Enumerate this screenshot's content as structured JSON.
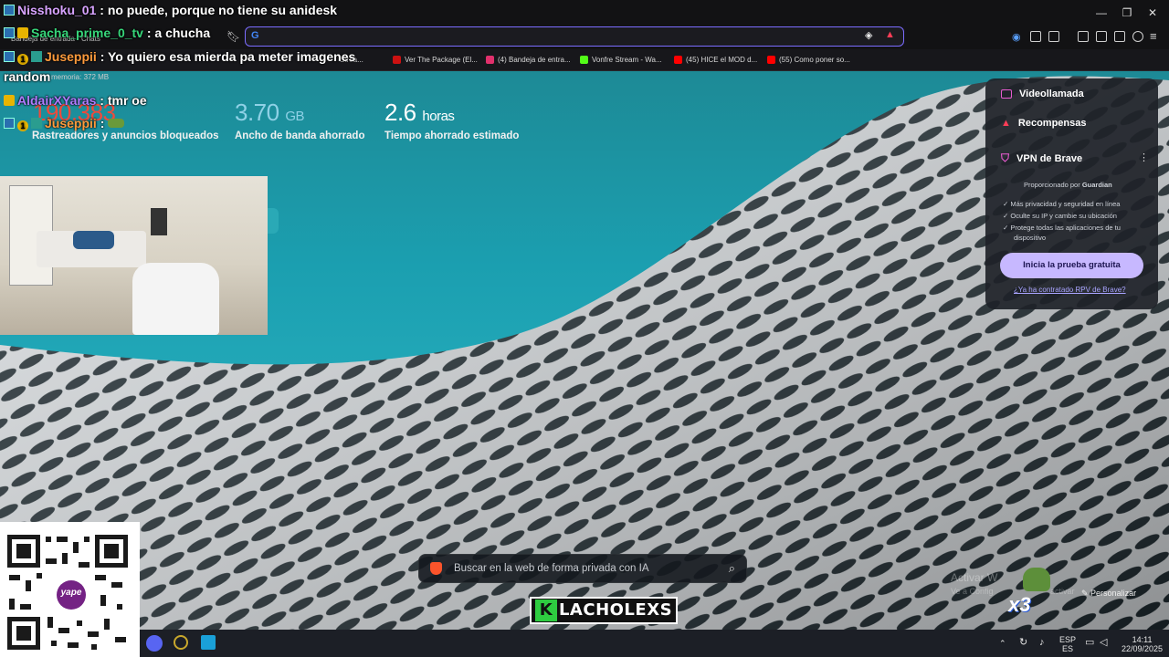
{
  "chat": [
    {
      "user": "Nisshoku_01",
      "user_color": "#d7a3ff",
      "message": ": no puede, porque no tiene su anidesk"
    },
    {
      "user": "Sacha_prime_0_tv",
      "user_color": "#37d67a",
      "message": ": a chucha"
    },
    {
      "user": "Juseppii",
      "user_color": "#ff9a3c",
      "message": ": Yo quiero esa mierda pa meter imagenes"
    },
    {
      "user": "",
      "user_color": "#ffffff",
      "message": "random"
    },
    {
      "user": "AldairXYaras",
      "user_color": "#b07bff",
      "message": ": tmr oe"
    },
    {
      "user": "Juseppii",
      "user_color": "#ff9a3c",
      "message": ":"
    }
  ],
  "tabs": {
    "tab1": "Bandeja de entrada - Chats",
    "memory": "memoria: 372 MB"
  },
  "bookmarks": [
    {
      "label": "Strea...",
      "color": "#9146ff"
    },
    {
      "label": "Ver The Package (El...",
      "color": "#c11"
    },
    {
      "label": "(4) Bandeja de entra...",
      "color": "#e1306c"
    },
    {
      "label": "Vonfre Stream - Wa...",
      "color": "#53fc18"
    },
    {
      "label": "(45) HICE el MOD d...",
      "color": "#ff0000"
    },
    {
      "label": "(55) Como poner so...",
      "color": "#ff0000"
    }
  ],
  "stats": {
    "blocked_value": "190.383",
    "blocked_label": "Rastreadores y anuncios bloqueados",
    "bandwidth_value": "3.70",
    "bandwidth_unit": "GB",
    "bandwidth_label": "Ancho de banda ahorrado",
    "time_value": "2.6",
    "time_unit": "horas",
    "time_label": "Tiempo ahorrado estimado"
  },
  "panel": {
    "video": "Videollamada",
    "rewards": "Recompensas",
    "vpn": "VPN de Brave",
    "provided": "Proporcionado por",
    "provider": "Guardian",
    "features": [
      "Más privacidad y seguridad en línea",
      "Oculte su IP y cambie su ubicación",
      "Protege todas las aplicaciones de tu",
      "dispositivo"
    ],
    "cta": "Inicia la prueba gratuita",
    "link": "¿Ya ha contratado RPV de Brave?"
  },
  "search": {
    "placeholder": "Buscar en la web de forma privada con IA"
  },
  "activate": {
    "line1": "Activar W",
    "line2": "Ve a Config",
    "line3": "activar"
  },
  "customize": "Personalizar",
  "emote_count": "x3",
  "logo_text": "LACHOLEXS",
  "logo_k": "K",
  "qr_brand": "yape",
  "taskbar": {
    "lang1": "ESP",
    "lang2": "ES",
    "time": "14:11",
    "date": "22/09/2025"
  },
  "colors": {
    "accent": "#7b6cff",
    "teal": "#1b9fb0"
  }
}
